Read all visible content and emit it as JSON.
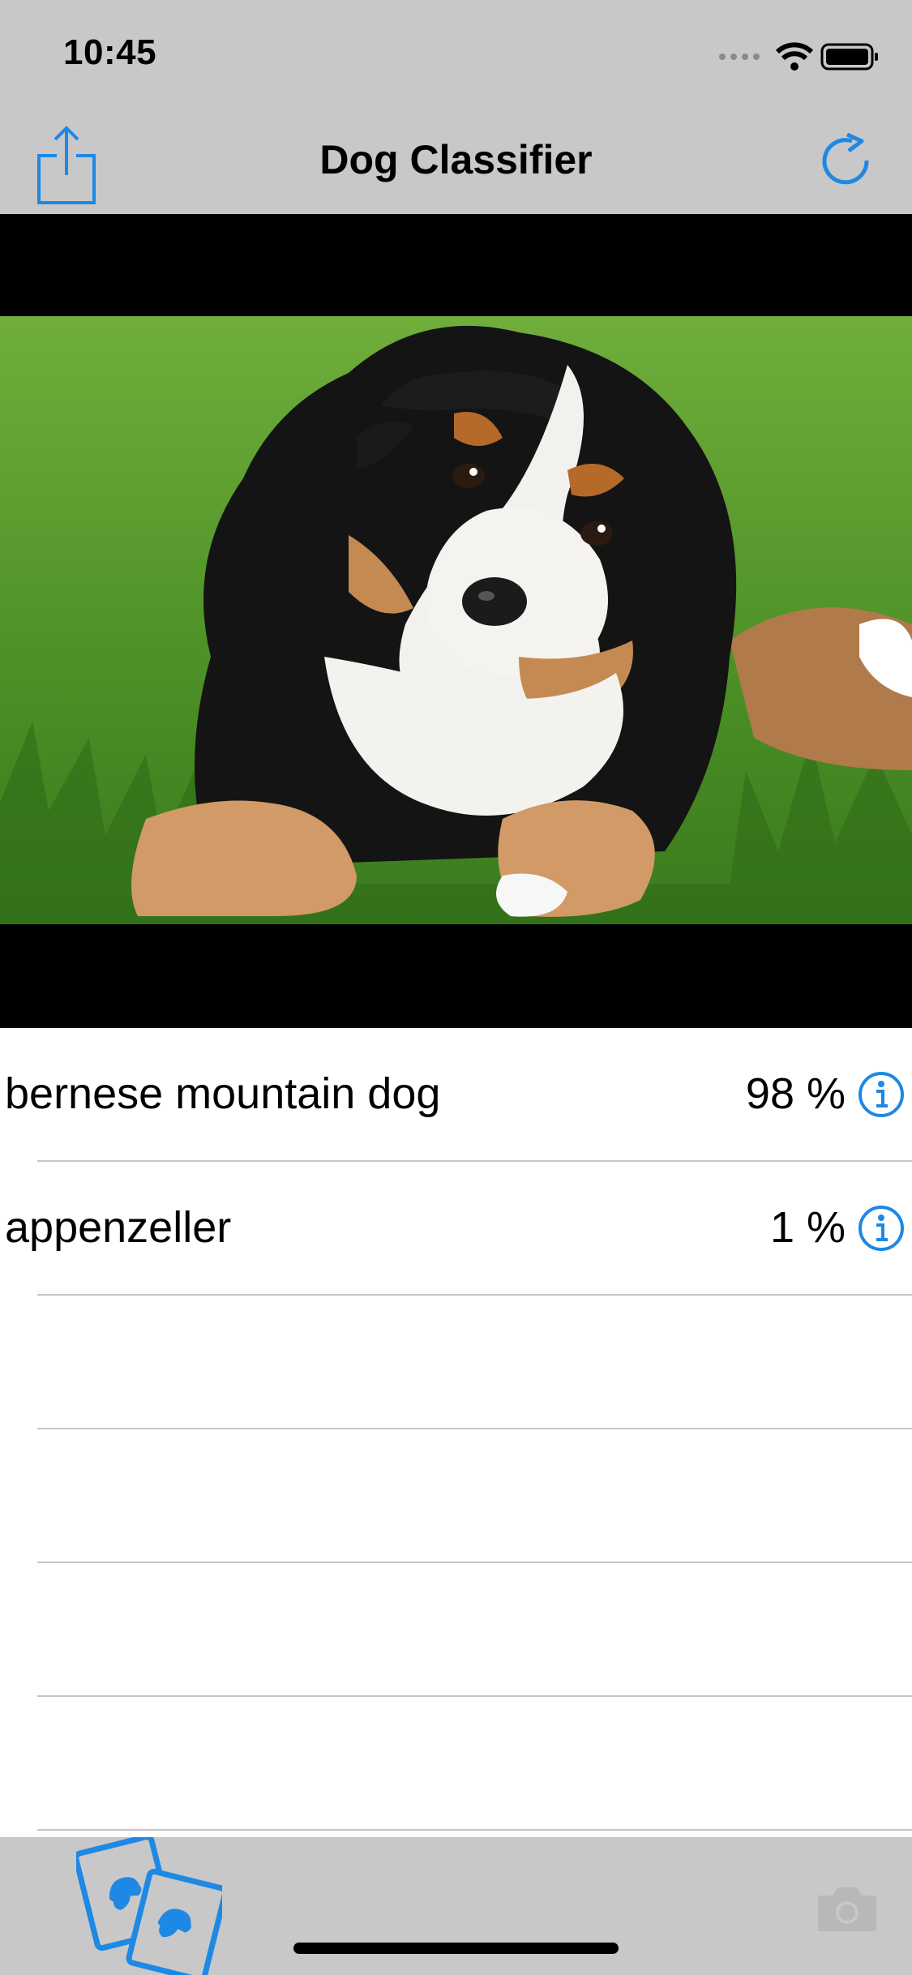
{
  "status_bar": {
    "time": "10:45",
    "icons": [
      "cellular-icon",
      "wifi-icon",
      "battery-icon"
    ]
  },
  "nav": {
    "title": "Dog Classifier",
    "left_icon": "share-icon",
    "right_icon": "refresh-icon"
  },
  "photo": {
    "subject": "bernese-mountain-dog-puppy"
  },
  "results": [
    {
      "breed": "bernese mountain dog",
      "percent": "98 %",
      "icon": "info-icon"
    },
    {
      "breed": "appenzeller",
      "percent": "1 %",
      "icon": "info-icon"
    }
  ],
  "tabs": [
    {
      "icon": "dog-photos-icon",
      "selected": true
    },
    {
      "icon": "camera-icon",
      "selected": false
    }
  ],
  "colors": {
    "accent": "#1e88e5",
    "bars": "#c8c8c8"
  }
}
